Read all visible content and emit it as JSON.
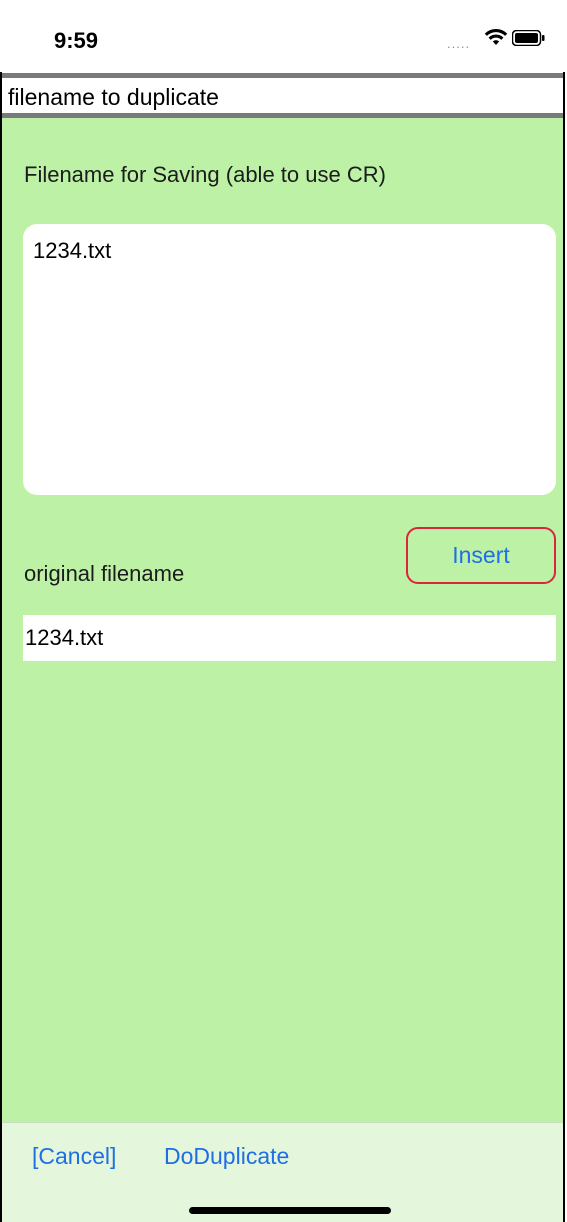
{
  "status_bar": {
    "time": "9:59",
    "signal_icon": "signal-dots",
    "wifi_icon": "wifi-icon",
    "battery_icon": "battery-icon"
  },
  "header": {
    "title": "filename to duplicate"
  },
  "form": {
    "save_label": "Filename for Saving (able to use CR)",
    "save_value": "1234.txt",
    "insert_label": "Insert",
    "original_label": "original filename",
    "original_value": "1234.txt"
  },
  "toolbar": {
    "cancel_label": "[Cancel]",
    "duplicate_label": "DoDuplicate"
  },
  "colors": {
    "background": "#bdf2a6",
    "toolbar": "#e4f7dc",
    "accent": "#1e6fe6",
    "insert_border": "#d9263a"
  }
}
